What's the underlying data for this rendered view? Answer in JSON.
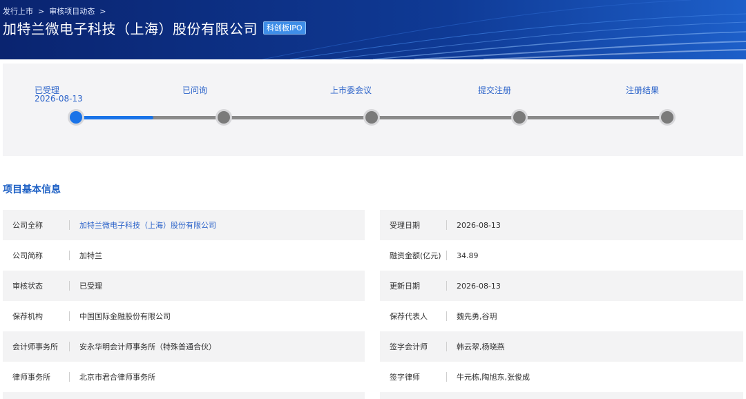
{
  "breadcrumb": [
    "发行上市",
    "审核项目动态"
  ],
  "breadcrumb_sep": ">",
  "company_title": "加特兰微电子科技（上海）股份有限公司",
  "board_badge": "科创板IPO",
  "progress": {
    "steps": [
      {
        "label": "已受理",
        "date": "2026-08-13"
      },
      {
        "label": "已问询",
        "date": ""
      },
      {
        "label": "上市委会议",
        "date": ""
      },
      {
        "label": "提交注册",
        "date": ""
      },
      {
        "label": "注册结果",
        "date": ""
      }
    ],
    "completed_fraction": 0.13
  },
  "section_title": "项目基本信息",
  "left_info": [
    {
      "label": "公司全称",
      "value": "加特兰微电子科技（上海）股份有限公司",
      "link": true
    },
    {
      "label": "公司简称",
      "value": "加特兰"
    },
    {
      "label": "审核状态",
      "value": "已受理"
    },
    {
      "label": "保荐机构",
      "value": "中国国际金融股份有限公司"
    },
    {
      "label": "会计师事务所",
      "value": "安永华明会计师事务所（特殊普通合伙）"
    },
    {
      "label": "律师事务所",
      "value": "北京市君合律师事务所"
    }
  ],
  "right_info": [
    {
      "label": "受理日期",
      "value": "2026-08-13"
    },
    {
      "label": "融资金额(亿元)",
      "value": "34.89"
    },
    {
      "label": "更新日期",
      "value": "2026-08-13"
    },
    {
      "label": "保荐代表人",
      "value": "魏先勇,谷玥"
    },
    {
      "label": "签字会计师",
      "value": "韩云翠,杨晓燕"
    },
    {
      "label": "签字律师",
      "value": "牛元栋,陶旭东,张俊成"
    }
  ],
  "colors": {
    "header": "#0b2a7a",
    "accent": "#1a73e8",
    "link": "#2a62c9"
  },
  "icons": [
    "chevron-right-icon"
  ]
}
